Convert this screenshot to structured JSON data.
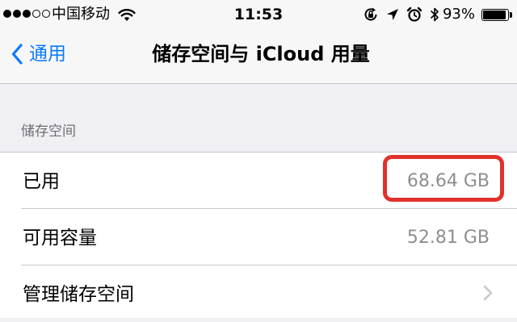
{
  "status_bar": {
    "carrier": "中国移动",
    "time": "11:53",
    "battery_percent": "93%",
    "battery_level": 0.93,
    "signal_bars_filled": 3,
    "signal_bars_total": 5
  },
  "nav": {
    "back_label": "通用",
    "title": "储存空间与 iCloud 用量"
  },
  "section": {
    "header": "储存空间",
    "rows": [
      {
        "label": "已用",
        "value": "68.64 GB",
        "highlighted": true
      },
      {
        "label": "可用容量",
        "value": "52.81 GB"
      },
      {
        "label": "管理储存空间",
        "value": "",
        "disclosure": true
      }
    ]
  },
  "colors": {
    "accent": "#0a7aff",
    "highlight": "#e0322b",
    "secondary_text": "#8e8e93",
    "background": "#efeff4"
  },
  "icons": {
    "back": "chevron-left-icon",
    "wifi": "wifi-icon",
    "rotation_lock": "rotation-lock-icon",
    "location": "location-arrow-icon",
    "alarm": "alarm-clock-icon",
    "bluetooth": "bluetooth-icon",
    "battery": "battery-icon",
    "disclosure": "chevron-right-icon"
  }
}
